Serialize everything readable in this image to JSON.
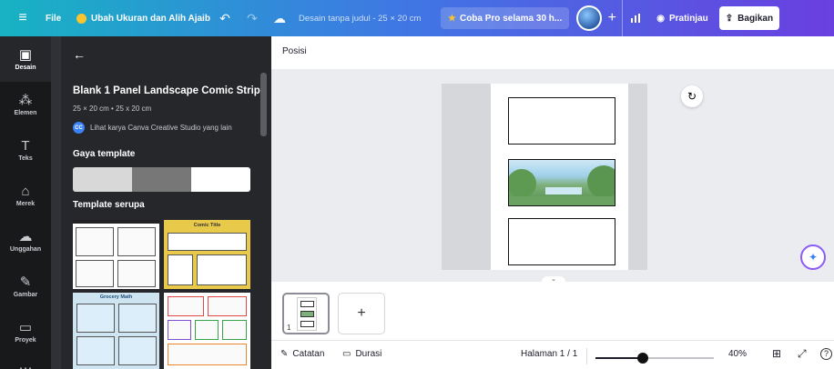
{
  "topbar": {
    "file": "File",
    "resize": "Ubah Ukuran dan Alih Ajaib",
    "undo_icon": "undo-icon",
    "redo_icon": "redo-icon",
    "cloud_icon": "cloud-check-icon",
    "doc_title": "Desain tanpa judul - 25 × 20 cm",
    "pro": "Coba Pro selama 30 h...",
    "plus": "+",
    "stats_icon": "bar-chart-icon",
    "preview": "Pratinjau",
    "share": "Bagikan"
  },
  "rail": {
    "items": [
      {
        "label": "Desain",
        "glyph": "▣"
      },
      {
        "label": "Elemen",
        "glyph": "⁂"
      },
      {
        "label": "Teks",
        "glyph": "T"
      },
      {
        "label": "Merek",
        "glyph": "⌂"
      },
      {
        "label": "Unggahan",
        "glyph": "☁"
      },
      {
        "label": "Gambar",
        "glyph": "✎"
      },
      {
        "label": "Proyek",
        "glyph": "▭"
      },
      {
        "label": "",
        "glyph": "⋯"
      }
    ]
  },
  "panel": {
    "back": "←",
    "title": "Blank 1 Panel Landscape Comic Strip",
    "size": "25 × 20 cm • 25 x 20 cm",
    "author_badge": "CC",
    "author": "Lihat karya Canva Creative Studio yang lain",
    "style_heading": "Gaya template",
    "swatch_colors": [
      "#d8d8d8",
      "#777777",
      "#ffffff"
    ],
    "similar_heading": "Template serupa",
    "thumb_captions": [
      "Comic Title",
      "Grocery Math"
    ]
  },
  "canvas": {
    "position_label": "Posisi",
    "refresh_icon": "↻",
    "magic_icon": "✦",
    "chevron": "⌄",
    "panel_colors": {
      "border": "#111111",
      "sky": "#9fd0ea",
      "grass": "#4e8c44"
    }
  },
  "pages": {
    "thumb_number": "1",
    "add": "+"
  },
  "bottombar": {
    "notes": "Catatan",
    "duration": "Durasi",
    "page_info": "Halaman 1 / 1",
    "zoom": "40%",
    "zoom_level": 0.4,
    "grid_icon": "⊞",
    "fullscreen_icon": "⤢",
    "help_icon": "?"
  }
}
